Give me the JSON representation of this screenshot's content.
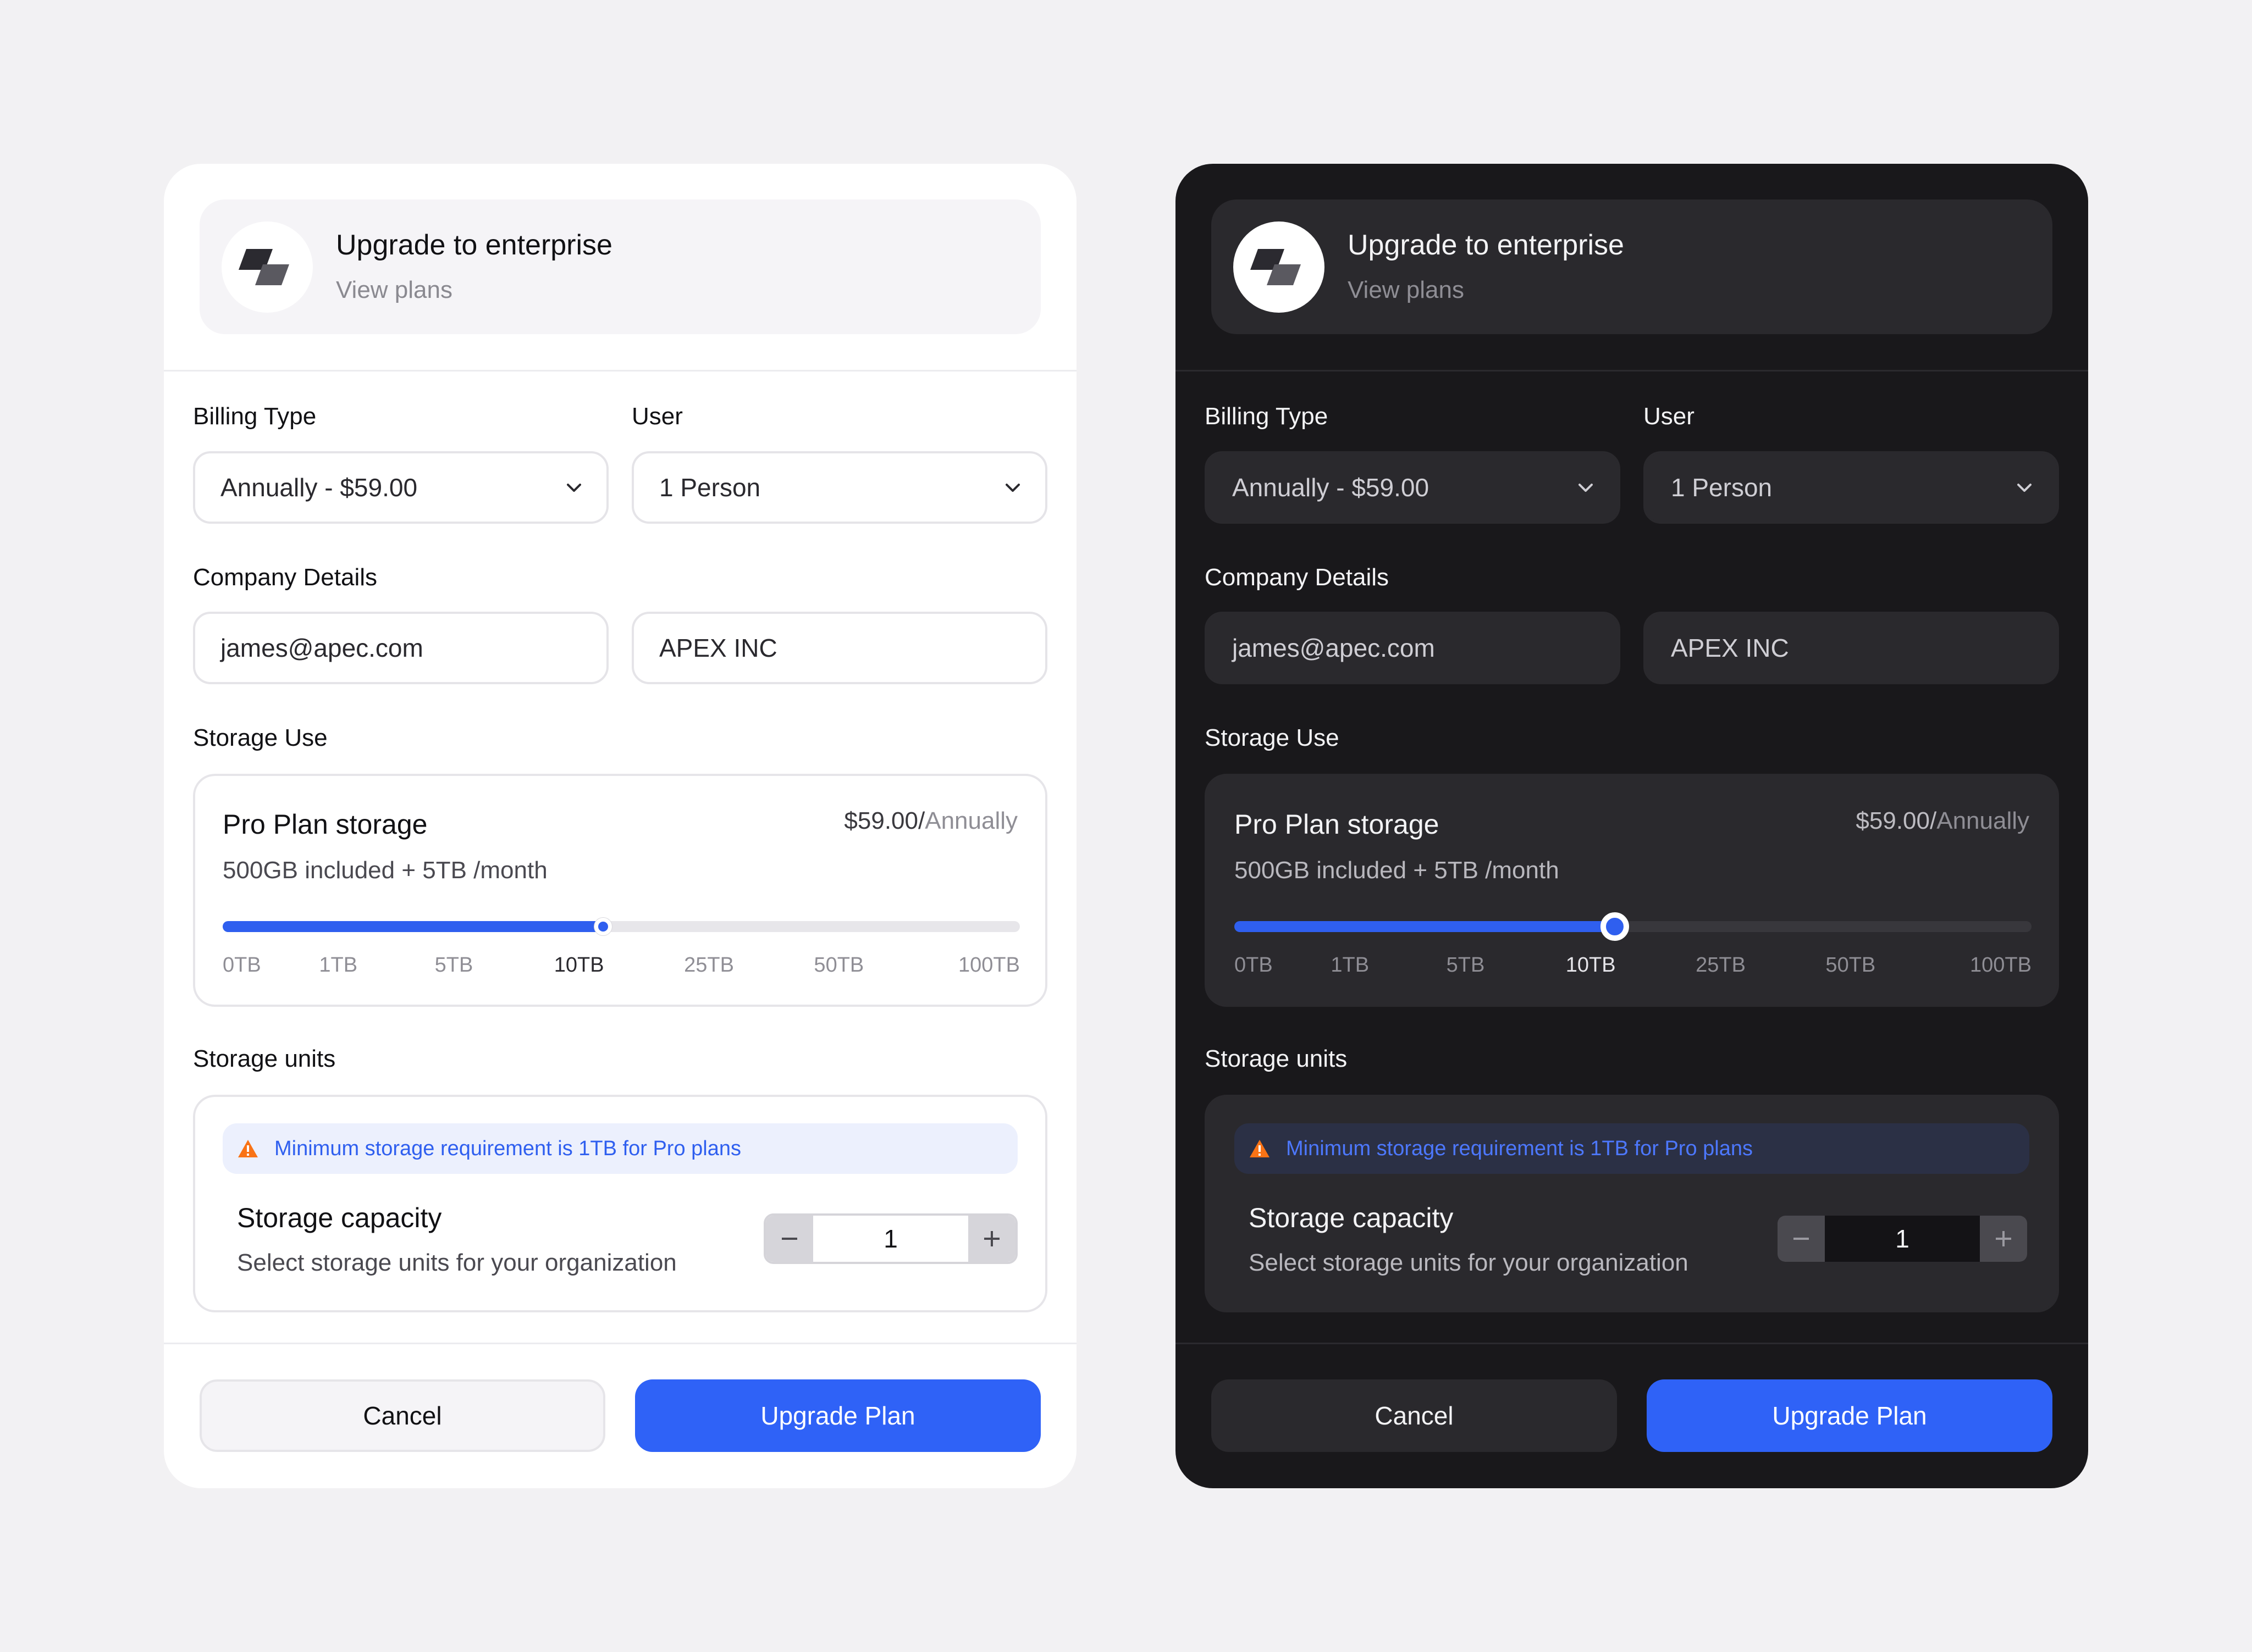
{
  "header": {
    "title": "Upgrade to enterprise",
    "subtitle": "View plans"
  },
  "billing": {
    "label": "Billing Type",
    "value": "Annually - $59.00"
  },
  "user": {
    "label": "User",
    "value": "1 Person"
  },
  "company": {
    "label": "Company Details",
    "email": "james@apec.com",
    "name": "APEX INC"
  },
  "storage_use": {
    "label": "Storage Use",
    "plan_title": "Pro Plan storage",
    "price_amount": "$59.00/",
    "price_period": "Annually",
    "description": "500GB included + 5TB /month",
    "slider_value": "10TB",
    "slider_fraction": 0.4775,
    "ticks": [
      "0TB",
      "1TB",
      "5TB",
      "10TB",
      "25TB",
      "50TB",
      "100TB"
    ],
    "active_tick_index": 3
  },
  "storage_units": {
    "label": "Storage units",
    "notice": "Minimum storage requirement is 1TB for Pro plans",
    "capacity_title": "Storage capacity",
    "capacity_subtitle": "Select storage units for your organization",
    "quantity": "1"
  },
  "actions": {
    "cancel_label": "Cancel",
    "upgrade_label": "Upgrade Plan"
  },
  "colors": {
    "accent": "#2f62f7",
    "warning": "#f97316",
    "light_card": "#ffffff",
    "dark_card": "#19181b",
    "page_background": "#f2f1f3"
  }
}
